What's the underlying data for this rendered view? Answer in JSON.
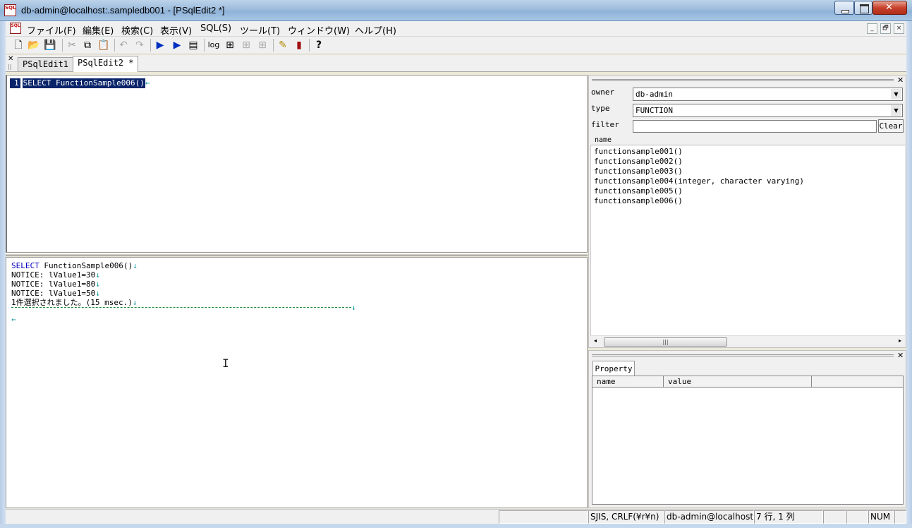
{
  "window": {
    "title": "db-admin@localhost:.sampledb001 - [PSqlEdit2 *]",
    "app_icon_text": "SQL",
    "colors": {
      "selection": "#0a246a",
      "keyword": "#0000c0",
      "eol_marker": "#1a9aa0",
      "separator_line": "#1a8a3a"
    }
  },
  "menubar": {
    "items": [
      "ファイル(F)",
      "編集(E)",
      "検索(C)",
      "表示(V)",
      "SQL(S)",
      "ツール(T)",
      "ウィンドウ(W)",
      "ヘルプ(H)"
    ],
    "mdi_buttons": [
      "_",
      "🗗",
      "×"
    ]
  },
  "toolbar": {
    "buttons": [
      {
        "name": "new-file-icon",
        "glyph": "🗋"
      },
      {
        "name": "open-folder-icon",
        "glyph": "📂"
      },
      {
        "name": "save-icon",
        "glyph": "💾"
      },
      {
        "name": "cut-icon",
        "glyph": "✂"
      },
      {
        "name": "copy-icon",
        "glyph": "⧉"
      },
      {
        "name": "paste-icon",
        "glyph": "📋"
      },
      {
        "name": "undo-icon",
        "glyph": "↶"
      },
      {
        "name": "redo-icon",
        "glyph": "↷"
      },
      {
        "name": "execute-icon",
        "glyph": "▶"
      },
      {
        "name": "execute-step-icon",
        "glyph": "▶"
      },
      {
        "name": "explain-icon",
        "glyph": "▤"
      },
      {
        "name": "log-icon",
        "glyph": "log"
      },
      {
        "name": "grid-icon",
        "glyph": "⊞"
      },
      {
        "name": "grid-disabled-icon",
        "glyph": "⊞"
      },
      {
        "name": "grid-disabled-2-icon",
        "glyph": "⊞"
      },
      {
        "name": "pencil-icon",
        "glyph": "✎"
      },
      {
        "name": "book-icon",
        "glyph": "▮"
      },
      {
        "name": "help-icon",
        "glyph": "?"
      }
    ]
  },
  "tabs": [
    {
      "label": "PSqlEdit1 *",
      "active": false
    },
    {
      "label": "PSqlEdit2 *",
      "active": true
    }
  ],
  "editor": {
    "line_number": "1",
    "code": "SELECT FunctionSample006()",
    "eol_marker": "←"
  },
  "output": {
    "lines": [
      {
        "keyword": "SELECT",
        "text": " FunctionSample006()",
        "end": "↓"
      },
      {
        "keyword": "",
        "text": "NOTICE:  lValue1=30",
        "end": "↓"
      },
      {
        "keyword": "",
        "text": "NOTICE:  lValue1=80",
        "end": "↓"
      },
      {
        "keyword": "",
        "text": "NOTICE:  lValue1=50",
        "end": "↓"
      },
      {
        "keyword": "",
        "text": "1件選択されました。(15 msec.)",
        "end": "↓"
      }
    ],
    "separator_end": "↓",
    "last_line_marker": "←"
  },
  "object_browser": {
    "owner_label": "owner",
    "owner_value": "db-admin",
    "type_label": "type",
    "type_value": "FUNCTION",
    "filter_label": "filter",
    "filter_value": "",
    "clear_label": "Clear",
    "list_header": "name",
    "items": [
      "functionsample001()",
      "functionsample002()",
      "functionsample003()",
      "functionsample004(integer, character varying)",
      "functionsample005()",
      "functionsample006()"
    ]
  },
  "property_panel": {
    "tab_label": "Property",
    "columns": [
      "name",
      "value"
    ]
  },
  "statusbar": {
    "encoding": "SJIS, CRLF(¥r¥n)",
    "connection": "db-admin@localhost:",
    "position": "7 行, 1 列",
    "num": "NUM"
  }
}
